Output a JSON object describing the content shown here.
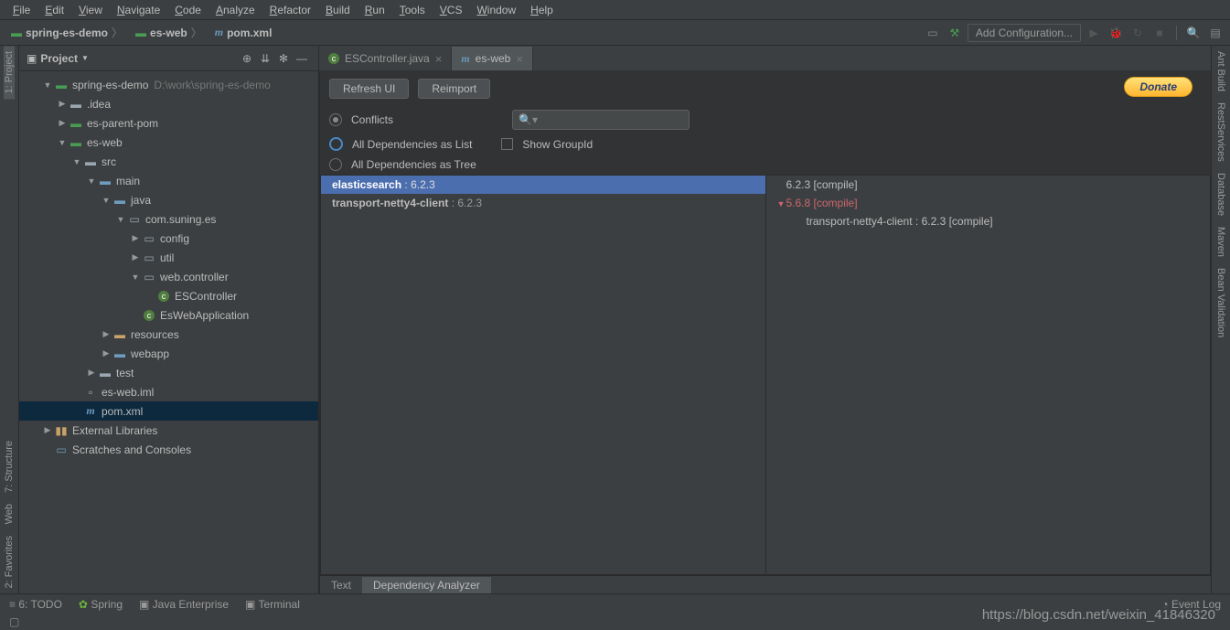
{
  "menu": [
    "File",
    "Edit",
    "View",
    "Navigate",
    "Code",
    "Analyze",
    "Refactor",
    "Build",
    "Run",
    "Tools",
    "VCS",
    "Window",
    "Help"
  ],
  "breadcrumbs": [
    {
      "icon": "module",
      "label": "spring-es-demo"
    },
    {
      "icon": "module",
      "label": "es-web"
    },
    {
      "icon": "m",
      "label": "pom.xml"
    }
  ],
  "nav": {
    "add_config": "Add Configuration..."
  },
  "left_gutter": [
    {
      "label": "1: Project",
      "icon": "window"
    },
    {
      "label": "7: Structure",
      "icon": "structure"
    },
    {
      "label": "Web",
      "icon": "web"
    },
    {
      "label": "2: Favorites",
      "icon": "star"
    }
  ],
  "right_gutter": [
    {
      "label": "Ant Build",
      "icon": "ant"
    },
    {
      "label": "RestServices",
      "icon": "globe"
    },
    {
      "label": "Database",
      "icon": "db"
    },
    {
      "label": "Maven",
      "icon": "m"
    },
    {
      "label": "Bean Validation",
      "icon": "bean"
    }
  ],
  "project_panel": {
    "title": "Project",
    "tree": {
      "root": {
        "label": "spring-es-demo",
        "path": "D:\\work\\spring-es-demo"
      },
      "items": [
        {
          "depth": 1,
          "arrow": "▼",
          "icon": "module",
          "label": "spring-es-demo",
          "sub": "D:\\work\\spring-es-demo",
          "selected": false
        },
        {
          "depth": 2,
          "arrow": "▶",
          "icon": "folder",
          "label": ".idea"
        },
        {
          "depth": 2,
          "arrow": "▶",
          "icon": "module",
          "label": "es-parent-pom"
        },
        {
          "depth": 2,
          "arrow": "▼",
          "icon": "module",
          "label": "es-web"
        },
        {
          "depth": 3,
          "arrow": "▼",
          "icon": "folder",
          "label": "src"
        },
        {
          "depth": 4,
          "arrow": "▼",
          "icon": "folder-blue",
          "label": "main"
        },
        {
          "depth": 5,
          "arrow": "▼",
          "icon": "folder-blue",
          "label": "java"
        },
        {
          "depth": 6,
          "arrow": "▼",
          "icon": "package",
          "label": "com.suning.es"
        },
        {
          "depth": 7,
          "arrow": "▶",
          "icon": "package",
          "label": "config"
        },
        {
          "depth": 7,
          "arrow": "▶",
          "icon": "package",
          "label": "util"
        },
        {
          "depth": 7,
          "arrow": "▼",
          "icon": "package",
          "label": "web.controller"
        },
        {
          "depth": 8,
          "arrow": "",
          "icon": "class",
          "label": "ESController"
        },
        {
          "depth": 7,
          "arrow": "",
          "icon": "class",
          "label": "EsWebApplication"
        },
        {
          "depth": 5,
          "arrow": "▶",
          "icon": "folder-res",
          "label": "resources"
        },
        {
          "depth": 5,
          "arrow": "▶",
          "icon": "folder-web",
          "label": "webapp"
        },
        {
          "depth": 4,
          "arrow": "▶",
          "icon": "folder",
          "label": "test"
        },
        {
          "depth": 3,
          "arrow": "",
          "icon": "file",
          "label": "es-web.iml"
        },
        {
          "depth": 3,
          "arrow": "",
          "icon": "m",
          "label": "pom.xml",
          "selected": true
        },
        {
          "depth": 1,
          "arrow": "▶",
          "icon": "libs",
          "label": "External Libraries"
        },
        {
          "depth": 1,
          "arrow": "",
          "icon": "scratch",
          "label": "Scratches and Consoles"
        }
      ]
    }
  },
  "editor": {
    "tabs": [
      {
        "icon": "class",
        "label": "ESController.java",
        "active": false
      },
      {
        "icon": "m",
        "label": "es-web",
        "active": true
      }
    ],
    "buttons": {
      "refresh": "Refresh UI",
      "reimport": "Reimport",
      "donate": "Donate"
    },
    "radios": {
      "conflicts": "Conflicts",
      "all_list": "All Dependencies as List",
      "show_groupid": "Show GroupId",
      "all_tree": "All Dependencies as Tree"
    },
    "dep_left": [
      {
        "name": "elasticsearch",
        "ver": "6.2.3",
        "selected": true
      },
      {
        "name": "transport-netty4-client",
        "ver": "6.2.3",
        "selected": false
      }
    ],
    "dep_right": [
      {
        "indent": 0,
        "arrow": "",
        "text": "6.2.3 [compile]",
        "red": false,
        "bold": false
      },
      {
        "indent": 0,
        "arrow": "▼",
        "text": "5.6.8 [compile]",
        "red": true,
        "bold": false
      },
      {
        "indent": 1,
        "arrow": "",
        "name": "transport-netty4-client",
        "ver": "6.2.3 [compile]",
        "bold": true
      }
    ],
    "bottom_tabs": [
      {
        "label": "Text",
        "active": false
      },
      {
        "label": "Dependency Analyzer",
        "active": true
      }
    ]
  },
  "statusbar": {
    "items": [
      {
        "icon": "todo",
        "label": "6: TODO"
      },
      {
        "icon": "spring",
        "label": "Spring"
      },
      {
        "icon": "jee",
        "label": "Java Enterprise"
      },
      {
        "icon": "terminal",
        "label": "Terminal"
      }
    ],
    "event_log": "Event Log"
  },
  "watermark": "https://blog.csdn.net/weixin_41846320"
}
